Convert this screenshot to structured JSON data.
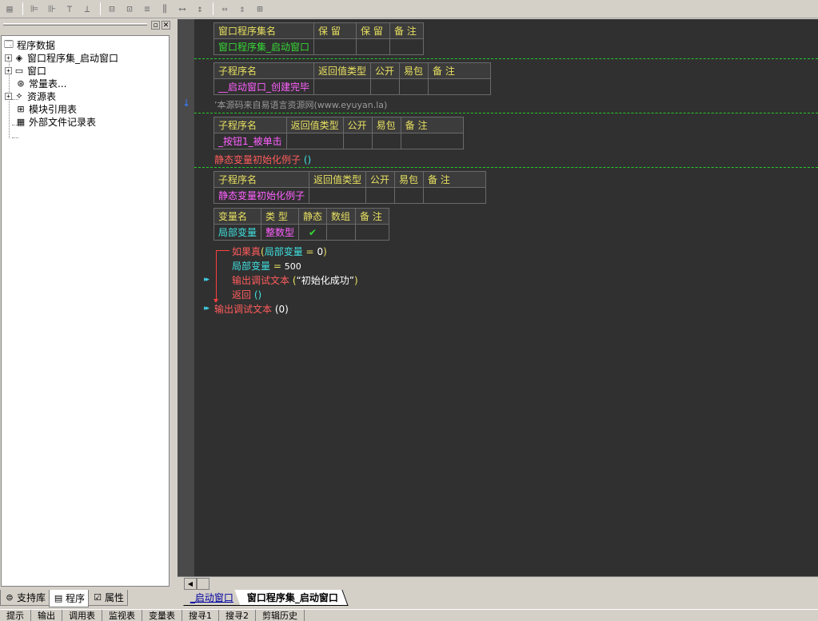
{
  "toolbar": {
    "icons": [
      "layout-icon",
      "align-left-icon",
      "align-right-icon",
      "align-top-icon",
      "align-bottom-icon",
      "center-horizontal-icon",
      "center-vertical-icon",
      "space-equal-icon",
      "space-between-icon",
      "width-icon",
      "height-icon",
      "equal-size-icon",
      "fit-width-icon",
      "fit-height-icon",
      "fit-both-icon"
    ]
  },
  "tree": {
    "items": [
      {
        "label": "程序数据",
        "icon": "program-data-icon"
      },
      {
        "label": "窗口程序集_启动窗口",
        "icon": "assembly-icon"
      },
      {
        "label": "窗口",
        "icon": "window-icon"
      },
      {
        "label": "常量表...",
        "icon": "constant-table-icon"
      },
      {
        "label": "资源表",
        "icon": "resource-table-icon"
      },
      {
        "label": "模块引用表",
        "icon": "module-ref-icon"
      },
      {
        "label": "外部文件记录表",
        "icon": "external-file-icon"
      }
    ]
  },
  "left_tabs": [
    {
      "label": "支持库"
    },
    {
      "label": "程序"
    },
    {
      "label": "属性"
    }
  ],
  "code": {
    "assembly_table": {
      "headers": [
        "窗口程序集名",
        "保 留",
        "保 留",
        "备 注"
      ],
      "row": [
        "窗口程序集_启动窗口",
        "",
        "",
        ""
      ]
    },
    "sub1_table": {
      "headers": [
        "子程序名",
        "返回值类型",
        "公开",
        "易包",
        "备 注"
      ],
      "row": [
        "__启动窗口_创建完毕",
        "",
        "",
        "",
        ""
      ]
    },
    "comment_line": "’本源码来自易语言资源网(www.eyuyan.la)",
    "sub2_table": {
      "headers": [
        "子程序名",
        "返回值类型",
        "公开",
        "易包",
        "备 注"
      ],
      "row": [
        "_按钮1_被单击",
        "",
        "",
        "",
        ""
      ]
    },
    "call_line": {
      "name": "静态变量初始化例子",
      "args": "()"
    },
    "sub3_table": {
      "headers": [
        "子程序名",
        "返回值类型",
        "公开",
        "易包",
        "备 注"
      ],
      "row": [
        "静态变量初始化例子",
        "",
        "",
        "",
        ""
      ]
    },
    "var_table": {
      "headers": [
        "变量名",
        "类 型",
        "静态",
        "数组",
        "备 注"
      ],
      "row": [
        "局部变量",
        "整数型",
        "✔",
        "",
        ""
      ]
    },
    "if_line": {
      "keyword": "如果真",
      "open": "(",
      "var": "局部变量",
      "op": "=",
      "value": "0",
      "close": ")"
    },
    "assign_line": {
      "var": "局部变量",
      "op": "=",
      "value": "500"
    },
    "debug_line1": {
      "func": "输出调试文本",
      "open": "(",
      "text": "“初始化成功”",
      "close": ")"
    },
    "return_line": {
      "keyword": "返回",
      "args": "()"
    },
    "debug_line2": {
      "func": "输出调试文本",
      "args": "(0)"
    }
  },
  "file_tabs": [
    {
      "label": "_启动窗口"
    },
    {
      "label": "窗口程序集_启动窗口"
    }
  ],
  "status_bar": {
    "items": [
      "提示",
      "输出",
      "调用表",
      "监视表",
      "变量表",
      "搜寻1",
      "搜寻2",
      "剪辑历史"
    ]
  }
}
